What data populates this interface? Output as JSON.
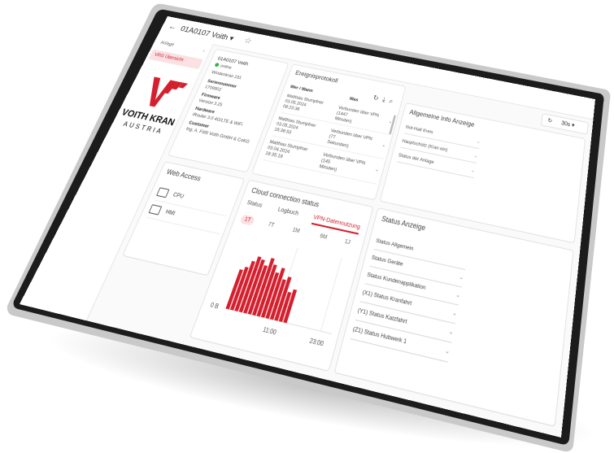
{
  "header": {
    "back_icon": "arrow-left-icon",
    "device_title": "01A0107 Voith ▾",
    "favorite_icon": "star-icon"
  },
  "sidebar": {
    "anlage_label": "Anlage",
    "anlage_chevron": "‹",
    "active_item": "VRG Übersicht"
  },
  "logo": {
    "brand_line1": "VOITH KRAN",
    "brand_line2": "AUSTRIA",
    "brand_color": "#d4202e"
  },
  "device_info": {
    "name": "01A0107 Voith",
    "status": "online",
    "subtitle": "Windenkran 231",
    "serial_label": "Seriennummer",
    "serial_value": "1709902",
    "firmware_label": "Firmware",
    "firmware_value": "Version 3.25",
    "hardware_label": "Hardware",
    "hardware_value": "iRouter 3.0 4G/LTE & WiFi",
    "customer_label": "Customer",
    "customer_value": "Ing. A. Fößl Voith GmbH & CoKG"
  },
  "events": {
    "title": "Ereignisprotokoll",
    "col_who": "Wer / Wann",
    "col_what": "Was",
    "rows": [
      {
        "who1": "Matthias Stumpfner",
        "who2": "03.05.2024",
        "who3": "08:23:36",
        "what1": "Verbunden über VPN (1447",
        "what2": "Minuten)"
      },
      {
        "who1": "Matthias Stumpfner",
        "who2": "03.05.2024",
        "who3": "16:36:53",
        "what1": "Verbunden über VPN (77",
        "what2": "Sekunden)"
      },
      {
        "who1": "Matthias Stumpfner",
        "who2": "03.04.2024",
        "who3": "16:35:19",
        "what1": "Verbunden über VPN (145",
        "what2": "Minuten)"
      }
    ]
  },
  "refresh": {
    "interval": "30s ▾"
  },
  "allgemeine_info": {
    "title": "Allgemeine Info Anzeige",
    "fields": [
      "Not-Halt Kreis",
      "Hauptschütz (Kran ein)",
      "Status der Anlage"
    ]
  },
  "web_access": {
    "title": "Web Access",
    "items": [
      "CPU",
      "HMI"
    ]
  },
  "cloud": {
    "title": "Cloud connection status",
    "tabs": [
      "Status",
      "Logbuch",
      "VPN-Datennutzung"
    ],
    "ranges": [
      "1T",
      "7T",
      "1M",
      "6M",
      "1J"
    ],
    "chart_data": {
      "type": "bar",
      "xlabel": "",
      "ylabel": "",
      "y_tick": "0 B",
      "x_ticks": [
        "11:00",
        "23:00"
      ],
      "values": [
        0.55,
        0.6,
        0.7,
        0.78,
        0.75,
        0.68,
        0.8,
        0.72,
        0.62,
        0.7,
        0.55,
        0.6,
        0.4,
        0.45
      ],
      "color": "#d4202e"
    }
  },
  "status": {
    "title": "Status Anzeige",
    "items": [
      "Status Allgemein",
      "Status Geräte",
      "Status Kundenapplikation",
      "(X1) Status Kranfahrt",
      "(Y1) Status Katzfahrt",
      "(Z1) Status Hubwerk 1"
    ]
  },
  "colors": {
    "accent": "#d4202e",
    "bezel": "#1c1c1c",
    "online": "#2fb34a"
  }
}
